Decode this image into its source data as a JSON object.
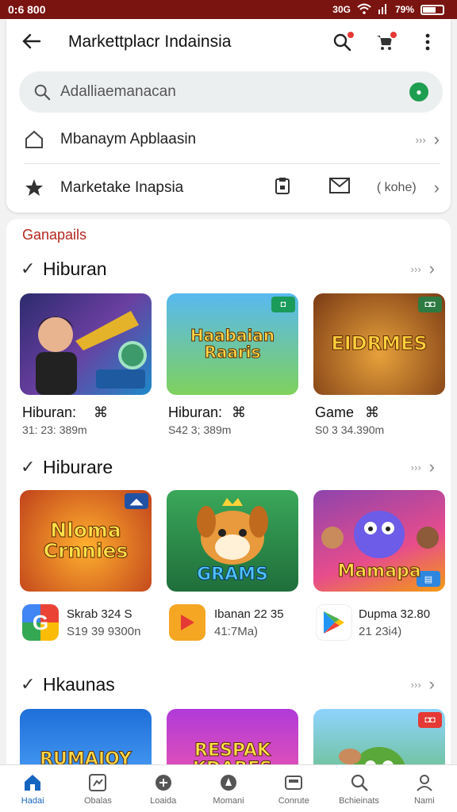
{
  "status": {
    "time": "0:6 800",
    "network": "30G",
    "battery": "79%"
  },
  "appbar": {
    "title": "Markettplacr Indainsia"
  },
  "search": {
    "placeholder": "Adalliaemanacan"
  },
  "menu": [
    {
      "label": "Mbanaym Apblaasin",
      "more": "›››"
    },
    {
      "label": "Marketake Inapsia",
      "extra": "( kohe)"
    }
  ],
  "content": {
    "header": "Ganapails",
    "sections": [
      {
        "title": "Hiburan",
        "more": "›››",
        "items": [
          {
            "art": "",
            "caption": "Hiburan:",
            "sub": "31: 23: 389m"
          },
          {
            "art": "Haabaian Raaris",
            "caption": "Hiburan:",
            "sub": "S42 3; 389m"
          },
          {
            "art": "EIDRMES",
            "caption": "Game",
            "sub": "S0 3 34.390m"
          }
        ]
      },
      {
        "title": "Hiburare",
        "more": "›››",
        "items": [
          {
            "art": "Nloma Crnnies",
            "app": "Skrab 324 S",
            "sub": "S19 39 9300n"
          },
          {
            "art": "GRAMS",
            "app": "Ibanan 22 35",
            "sub": "41:7Ma)"
          },
          {
            "art": "Mamapa",
            "app": "Dupma 32.80",
            "sub": "21 23i4)"
          }
        ]
      },
      {
        "title": "Hkaunas",
        "more": "›››",
        "items": [
          {
            "art": "RUMAIOY"
          },
          {
            "art": "RESPAK KDARES"
          },
          {
            "art": ""
          }
        ]
      }
    ]
  },
  "bottomnav": [
    "Hadai",
    "Obalas",
    "Loaida",
    "Momani",
    "Conrute",
    "Bchieinats",
    "Nami"
  ]
}
